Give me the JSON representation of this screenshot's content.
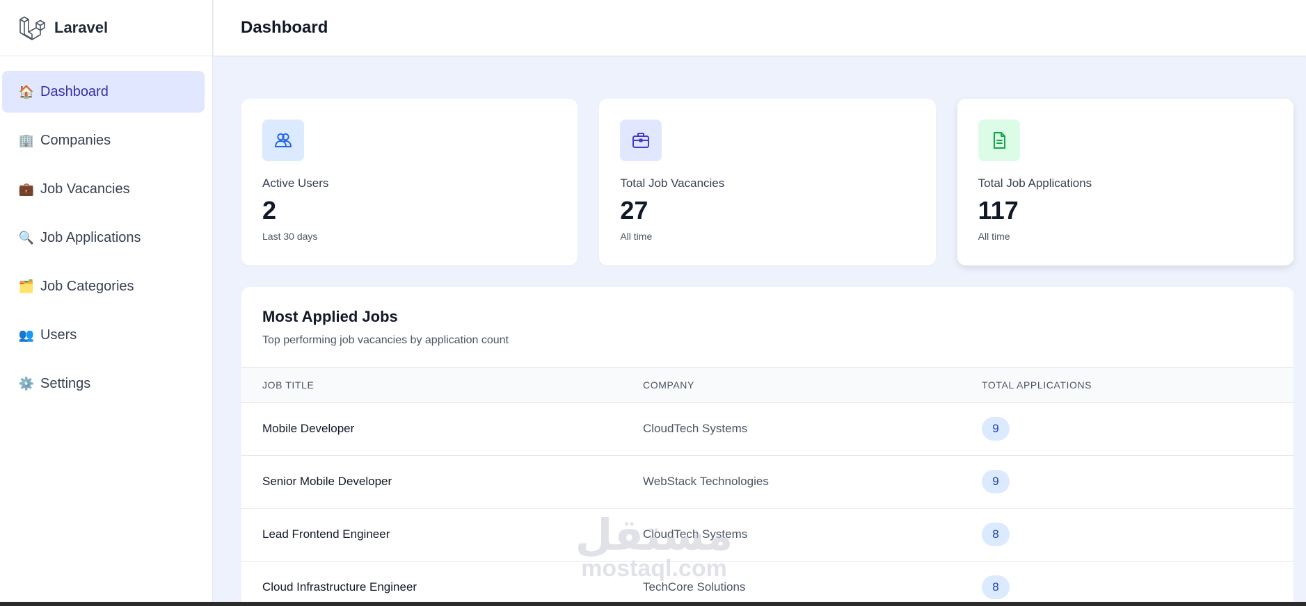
{
  "brand": {
    "name": "Laravel"
  },
  "header": {
    "title": "Dashboard"
  },
  "sidebar": {
    "items": [
      {
        "icon": "🏠",
        "label": "Dashboard",
        "active": true
      },
      {
        "icon": "🏢",
        "label": "Companies"
      },
      {
        "icon": "💼",
        "label": "Job Vacancies"
      },
      {
        "icon": "🔍",
        "label": "Job Applications"
      },
      {
        "icon": "🗂️",
        "label": "Job Categories"
      },
      {
        "icon": "👥",
        "label": "Users"
      },
      {
        "icon": "⚙️",
        "label": "Settings"
      }
    ]
  },
  "stats": [
    {
      "icon": "users-icon",
      "label": "Active Users",
      "value": "2",
      "sub": "Last 30 days",
      "color": "#dbeafe",
      "stroke": "#2563eb"
    },
    {
      "icon": "briefcase-icon",
      "label": "Total Job Vacancies",
      "value": "27",
      "sub": "All time",
      "color": "#e0e7ff",
      "stroke": "#4338ca"
    },
    {
      "icon": "document-icon",
      "label": "Total Job Applications",
      "value": "117",
      "sub": "All time",
      "color": "#dcfce7",
      "stroke": "#16a34a"
    }
  ],
  "most_applied": {
    "title": "Most Applied Jobs",
    "subtitle": "Top performing job vacancies by application count",
    "columns": [
      "JOB TITLE",
      "COMPANY",
      "TOTAL APPLICATIONS"
    ],
    "rows": [
      {
        "job": "Mobile Developer",
        "company": "CloudTech Systems",
        "total": "9"
      },
      {
        "job": "Senior Mobile Developer",
        "company": "WebStack Technologies",
        "total": "9"
      },
      {
        "job": "Lead Frontend Engineer",
        "company": "CloudTech Systems",
        "total": "8"
      },
      {
        "job": "Cloud Infrastructure Engineer",
        "company": "TechCore Solutions",
        "total": "8"
      }
    ]
  },
  "watermark": {
    "arabic": "مستقل",
    "latin": "mostaql.com"
  }
}
